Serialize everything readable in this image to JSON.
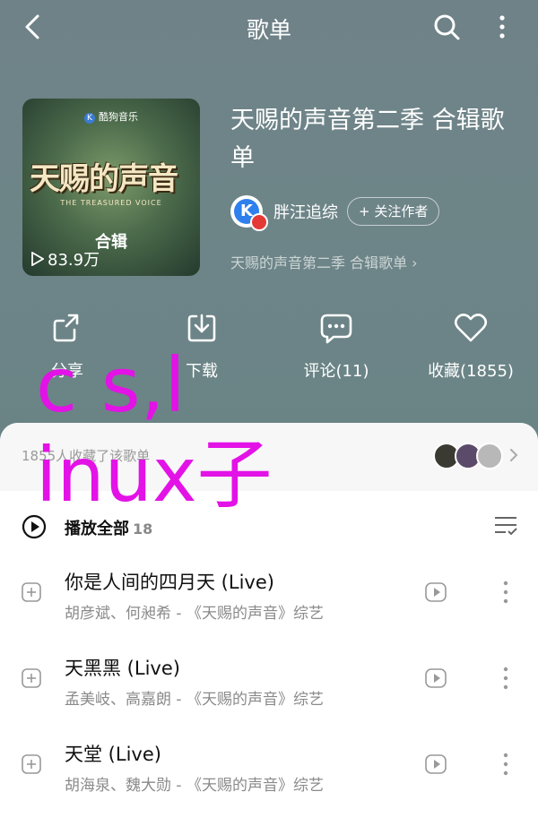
{
  "nav": {
    "title": "歌单",
    "back_icon": "chevron-left-icon",
    "search_icon": "search-icon",
    "more_icon": "more-vertical-icon"
  },
  "cover": {
    "brand": "酷狗音乐",
    "brand_logo_letter": "K",
    "show_name": "天赐的声音",
    "show_sub": "THE TREASURED VOICE",
    "label": "合辑",
    "play_count": "83.9万"
  },
  "playlist": {
    "title": "天赐的声音第二季 合辑歌单",
    "author": "胖汪追综",
    "follow_label": "+ 关注作者",
    "sub_link": "天赐的声音第二季 合辑歌单 ›"
  },
  "actions": [
    {
      "icon": "share-icon",
      "label": "分享"
    },
    {
      "icon": "download-icon",
      "label": "下载"
    },
    {
      "icon": "comment-icon",
      "label": "评论(11)"
    },
    {
      "icon": "heart-icon",
      "label": "收藏(1855)"
    }
  ],
  "favorites": {
    "text": "1855人收藏了该歌单"
  },
  "play_all": {
    "label": "播放全部",
    "count": "18"
  },
  "songs": [
    {
      "title": "你是人间的四月天 (Live)",
      "info": "胡彦斌、何昶希 - 《天赐的声音》综艺"
    },
    {
      "title": "天黑黑 (Live)",
      "info": "孟美岐、高嘉朗 - 《天赐的声音》综艺"
    },
    {
      "title": "天堂 (Live)",
      "info": "胡海泉、魏大勋 - 《天赐的声音》综艺"
    }
  ],
  "overlay_text": {
    "line1": "c s,l",
    "line2": "inux子"
  },
  "colors": {
    "header_bg": "#6f8288",
    "overlay": "#e312e6",
    "accent_blue": "#2f80ed"
  }
}
